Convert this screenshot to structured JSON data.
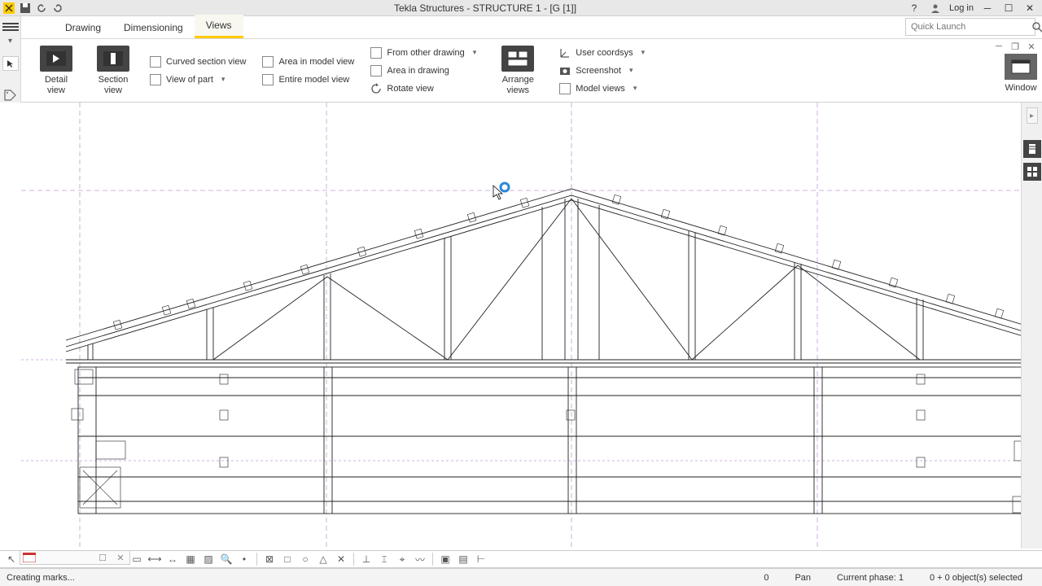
{
  "titlebar": {
    "app_title": "Tekla Structures - STRUCTURE 1 - [G   [1]]",
    "help": "?",
    "login": "Log in"
  },
  "tabs": {
    "drawing": "Drawing",
    "dimensioning": "Dimensioning",
    "views": "Views"
  },
  "quicklaunch": {
    "placeholder": "Quick Launch"
  },
  "ribbon": {
    "detail_view": "Detail view",
    "section_view": "Section view",
    "curved_section": "Curved section view",
    "view_of_part": "View of part",
    "area_model": "Area in model view",
    "entire_model": "Entire model view",
    "from_other": "From other drawing",
    "area_drawing": "Area in drawing",
    "rotate_view": "Rotate view",
    "arrange_views": "Arrange views",
    "user_coordsys": "User coordsys",
    "screenshot": "Screenshot",
    "model_views": "Model views",
    "window": "Window"
  },
  "statusbar": {
    "left": "Creating marks...",
    "zero": "0",
    "pan": "Pan",
    "phase": "Current phase: 1",
    "selection": "0 + 0 object(s) selected"
  }
}
